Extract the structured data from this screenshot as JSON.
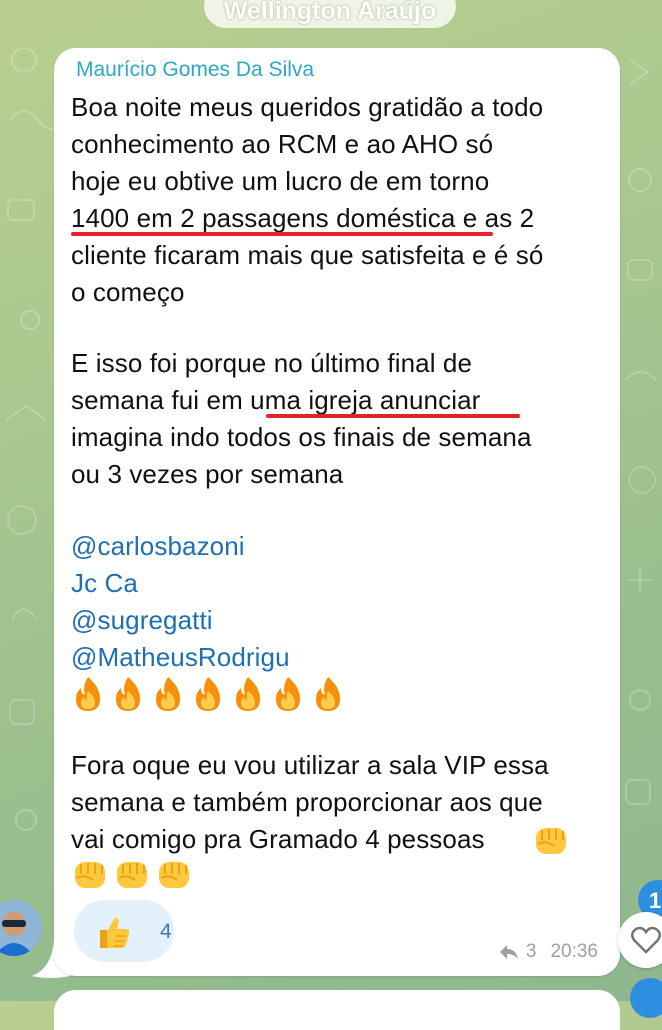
{
  "chat": {
    "top_sender_name": "Wellington Araújo"
  },
  "message": {
    "sender": "Maurício Gomes Da Silva",
    "lines": [
      "Boa noite meus queridos gratidão a todo",
      "conhecimento ao RCM e ao AHO  só",
      "hoje eu obtive um lucro de em torno",
      "1400 em 2 passagens doméstica e as 2",
      "cliente ficaram mais que satisfeita e é só",
      "o começo",
      "E isso foi porque no último final de",
      "semana fui em uma igreja anunciar",
      "imagina indo todos os finais de semana",
      "ou 3 vezes por semana",
      "Fora oque eu vou utilizar a sala VIP essa",
      "semana e também proporcionar aos que",
      "vai comigo pra Gramado 4 pessoas"
    ],
    "mentions": [
      "@carlosbazoni",
      "Jc Ca",
      "@sugregatti",
      "@MatheusRodrigu"
    ],
    "fire_emoji_count": 7,
    "fist_emoji_count": 4,
    "reaction": {
      "emoji": "thumbs-up",
      "count": "4"
    },
    "reply_count": "3",
    "time": "20:36"
  },
  "side": {
    "unread_badge": "1",
    "heart_icon": "heart-outline-icon"
  },
  "colors": {
    "sender_name": "#2aa8c4",
    "mention": "#1f6fb5",
    "highlight_underline": "#e8202a",
    "reaction_bg": "#e3f1fb",
    "badge": "#2e8ee0"
  }
}
